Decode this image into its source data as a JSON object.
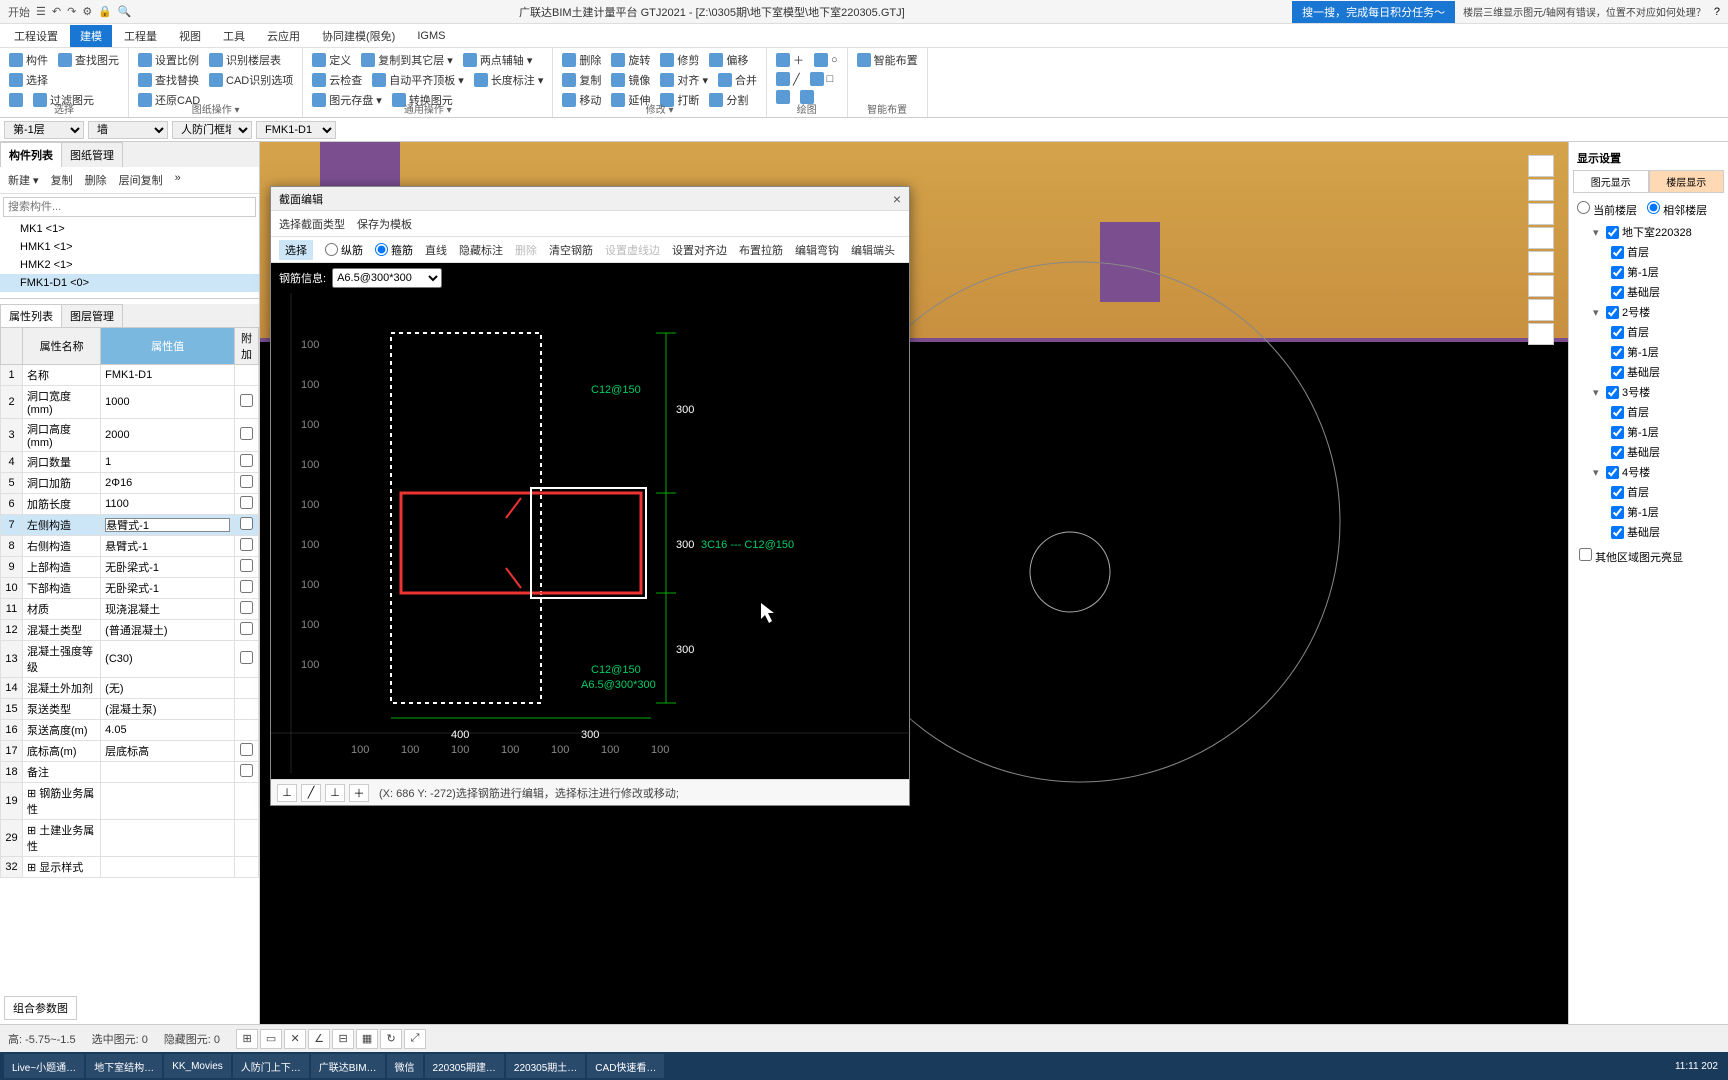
{
  "app_title": "广联达BIM土建计量平台 GTJ2021 - [Z:\\0305期\\地下室模型\\地下室220305.GTJ]",
  "banner": "搜一搜，完成每日积分任务～",
  "banner_question": "楼层三维显示图元/轴网有错误，位置不对应如何处理？",
  "qat": [
    "开始",
    "☰",
    "↶",
    "↷",
    "⚙",
    "🔒",
    "🔍"
  ],
  "menu": [
    "工程设置",
    "建模",
    "工程量",
    "视图",
    "工具",
    "云应用",
    "协同建模(限免)",
    "IGMS"
  ],
  "menu_active": 1,
  "ribbon_groups": [
    {
      "label": "选择",
      "items": [
        [
          "构件",
          "查找图元"
        ],
        [
          "选择"
        ],
        [
          "",
          "过滤图元"
        ]
      ]
    },
    {
      "label": "图纸操作 ▾",
      "items": [
        [
          "设置比例",
          "识别楼层表"
        ],
        [
          "查找替换",
          "CAD识别选项"
        ],
        [
          "还原CAD"
        ]
      ]
    },
    {
      "label": "通用操作 ▾",
      "items": [
        [
          "定义",
          "复制到其它层 ▾",
          "两点辅轴 ▾"
        ],
        [
          "云检查",
          "自动平齐顶板 ▾",
          "长度标注 ▾"
        ],
        [
          "图元存盘 ▾",
          "转换图元"
        ]
      ]
    },
    {
      "label": "修改 ▾",
      "items": [
        [
          "删除",
          "旋转",
          "修剪",
          "偏移"
        ],
        [
          "复制",
          "镜像",
          "对齐 ▾",
          "合并"
        ],
        [
          "移动",
          "延伸",
          "打断",
          "分割"
        ]
      ]
    },
    {
      "label": "绘图",
      "items": [
        [
          "＋",
          "○"
        ],
        [
          "╱",
          "□"
        ],
        [
          "",
          ""
        ]
      ]
    },
    {
      "label": "智能布置",
      "items": [
        [
          "智能布置"
        ]
      ]
    }
  ],
  "filters": {
    "floor": "第-1层",
    "cat": "墙",
    "sub": "人防门框墙",
    "item": "FMK1-D1"
  },
  "left_tabs": [
    "构件列表",
    "图纸管理"
  ],
  "left_tabs_active": 0,
  "toolbar_left": [
    "新建 ▾",
    "复制",
    "删除",
    "层间复制",
    "»"
  ],
  "search_placeholder": "搜索构件...",
  "components": [
    "MK1 <1>",
    "HMK1 <1>",
    "HMK2 <1>",
    "FMK1-D1 <0>"
  ],
  "component_sel": 3,
  "prop_tabs": [
    "属性列表",
    "图层管理"
  ],
  "prop_headers": [
    "",
    "属性名称",
    "属性值",
    "附加"
  ],
  "props": [
    {
      "n": "1",
      "name": "名称",
      "val": "FMK1-D1",
      "cb": false
    },
    {
      "n": "2",
      "name": "洞口宽度(mm)",
      "val": "1000",
      "cb": true
    },
    {
      "n": "3",
      "name": "洞口高度(mm)",
      "val": "2000",
      "cb": true
    },
    {
      "n": "4",
      "name": "洞口数量",
      "val": "1",
      "cb": true
    },
    {
      "n": "5",
      "name": "洞口加筋",
      "val": "2Φ16",
      "cb": true
    },
    {
      "n": "6",
      "name": "加筋长度",
      "val": "1100",
      "cb": true
    },
    {
      "n": "7",
      "name": "左侧构造",
      "val": "悬臂式-1",
      "cb": true,
      "sel": true
    },
    {
      "n": "8",
      "name": "右侧构造",
      "val": "悬臂式-1",
      "cb": true
    },
    {
      "n": "9",
      "name": "上部构造",
      "val": "无卧梁式-1",
      "cb": true
    },
    {
      "n": "10",
      "name": "下部构造",
      "val": "无卧梁式-1",
      "cb": true
    },
    {
      "n": "11",
      "name": "材质",
      "val": "现浇混凝土",
      "cb": true
    },
    {
      "n": "12",
      "name": "混凝土类型",
      "val": "(普通混凝土)",
      "cb": true
    },
    {
      "n": "13",
      "name": "混凝土强度等级",
      "val": "(C30)",
      "cb": true
    },
    {
      "n": "14",
      "name": "混凝土外加剂",
      "val": "(无)",
      "cb": false
    },
    {
      "n": "15",
      "name": "泵送类型",
      "val": "(混凝土泵)",
      "cb": false
    },
    {
      "n": "16",
      "name": "泵送高度(m)",
      "val": "4.05",
      "cb": false
    },
    {
      "n": "17",
      "name": "底标高(m)",
      "val": "层底标高",
      "cb": true
    },
    {
      "n": "18",
      "name": "备注",
      "val": "",
      "cb": true
    },
    {
      "n": "19",
      "name": "钢筋业务属性",
      "val": "",
      "cb": false,
      "grp": true
    },
    {
      "n": "29",
      "name": "土建业务属性",
      "val": "",
      "cb": false,
      "grp": true
    },
    {
      "n": "32",
      "name": "显示样式",
      "val": "",
      "cb": false,
      "grp": true
    }
  ],
  "combo_btn": "组合参数图",
  "dialog": {
    "title": "截面编辑",
    "row1": [
      "选择截面类型",
      "保存为模板"
    ],
    "row2_sel": "选择",
    "row2_radio": [
      {
        "t": "纵筋",
        "c": false
      },
      {
        "t": "箍筋",
        "c": true
      }
    ],
    "row2_links": [
      "直线",
      "隐藏标注",
      "删除",
      "清空钢筋",
      "设置虚线边",
      "设置对齐边",
      "布置拉筋",
      "编辑弯钩",
      "编辑端头"
    ],
    "info_label": "钢筋信息:",
    "info_val": "A6.5@300*300",
    "dims": {
      "top": "300",
      "mid": "300",
      "bot": "300",
      "w1": "400",
      "w2": "300",
      "ticks": "100"
    },
    "annot": [
      "C12@150",
      "3C16 --- C12@150",
      "C12@150",
      "A6.5@300*300"
    ],
    "footer_status": "(X: 686 Y: -272)选择钢筋进行编辑，选择标注进行修改或移动;"
  },
  "right": {
    "title": "显示设置",
    "tabs": [
      "图元显示",
      "楼层显示"
    ],
    "tabs_active": 1,
    "radios": [
      {
        "t": "当前楼层",
        "c": false
      },
      {
        "t": "相邻楼层",
        "c": true
      }
    ],
    "tree": [
      {
        "t": "地下室220328",
        "lv": 0,
        "c": true
      },
      {
        "t": "首层",
        "lv": 1,
        "c": true
      },
      {
        "t": "第-1层",
        "lv": 1,
        "c": true
      },
      {
        "t": "基础层",
        "lv": 1,
        "c": true
      },
      {
        "t": "2号楼",
        "lv": 0,
        "c": true
      },
      {
        "t": "首层",
        "lv": 1,
        "c": true
      },
      {
        "t": "第-1层",
        "lv": 1,
        "c": true
      },
      {
        "t": "基础层",
        "lv": 1,
        "c": true
      },
      {
        "t": "3号楼",
        "lv": 0,
        "c": true
      },
      {
        "t": "首层",
        "lv": 1,
        "c": true
      },
      {
        "t": "第-1层",
        "lv": 1,
        "c": true
      },
      {
        "t": "基础层",
        "lv": 1,
        "c": true
      },
      {
        "t": "4号楼",
        "lv": 0,
        "c": true
      },
      {
        "t": "首层",
        "lv": 1,
        "c": true
      },
      {
        "t": "第-1层",
        "lv": 1,
        "c": true
      },
      {
        "t": "基础层",
        "lv": 1,
        "c": true
      }
    ],
    "bottom_cb": "其他区域图元亮显"
  },
  "status": {
    "coords": "高: -5.75~-1.5",
    "sel": "选中图元: 0",
    "hid": "隐藏图元: 0"
  },
  "taskbar": [
    "Live~小题通…",
    "地下室结构…",
    "KK_Movies",
    "人防门上下…",
    "广联达BIM…",
    "微信",
    "220305期建…",
    "220305期土…",
    "CAD快速看…"
  ],
  "clock": "11:11\n202"
}
